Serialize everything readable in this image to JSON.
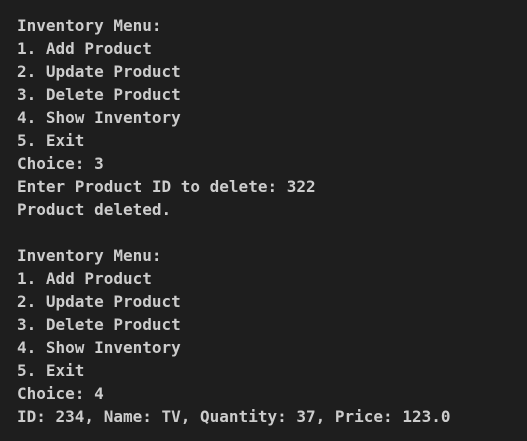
{
  "terminal": {
    "background": "#1e1e1e",
    "foreground": "#cccccc",
    "lines": [
      "Inventory Menu:",
      "1. Add Product",
      "2. Update Product",
      "3. Delete Product",
      "4. Show Inventory",
      "5. Exit",
      "Choice: 3",
      "Enter Product ID to delete: 322",
      "Product deleted.",
      "",
      "Inventory Menu:",
      "1. Add Product",
      "2. Update Product",
      "3. Delete Product",
      "4. Show Inventory",
      "5. Exit",
      "Choice: 4",
      "ID: 234, Name: TV, Quantity: 37, Price: 123.0"
    ]
  }
}
